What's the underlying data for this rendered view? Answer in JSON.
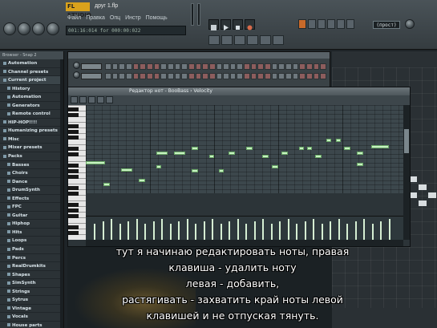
{
  "app": {
    "logo": "FL STUDIO",
    "window_title": "друг 1.flp"
  },
  "menu": [
    "Файл",
    "Правка",
    "Опц",
    "Инстр",
    "Помощь"
  ],
  "hint_panel": "001:16:014 for 000:00:022",
  "bpm_display": "(прост)",
  "browser": {
    "header": "Browser - Snap 2",
    "items": [
      {
        "label": "Automation",
        "level": 0
      },
      {
        "label": "Channel presets",
        "level": 0
      },
      {
        "label": "Current project",
        "level": 0
      },
      {
        "label": "History",
        "level": 1
      },
      {
        "label": "Automation",
        "level": 1
      },
      {
        "label": "Generators",
        "level": 1
      },
      {
        "label": "Remote control",
        "level": 1
      },
      {
        "label": "HIP-HOP!!!!",
        "level": 0
      },
      {
        "label": "Humanizing presets",
        "level": 0
      },
      {
        "label": "Misc",
        "level": 0
      },
      {
        "label": "Mixer presets",
        "level": 0
      },
      {
        "label": "Packs",
        "level": 0
      },
      {
        "label": "Basses",
        "level": 1
      },
      {
        "label": "Choirs",
        "level": 1
      },
      {
        "label": "Dance",
        "level": 1
      },
      {
        "label": "DrumSynth",
        "level": 1
      },
      {
        "label": "Effects",
        "level": 1
      },
      {
        "label": "FPC",
        "level": 1
      },
      {
        "label": "Guitar",
        "level": 1
      },
      {
        "label": "Hiphop",
        "level": 1
      },
      {
        "label": "Hits",
        "level": 1
      },
      {
        "label": "Loops",
        "level": 1
      },
      {
        "label": "Pads",
        "level": 1
      },
      {
        "label": "Percs",
        "level": 1
      },
      {
        "label": "RealDrumkits",
        "level": 1
      },
      {
        "label": "Shapes",
        "level": 1
      },
      {
        "label": "SimSynth",
        "level": 1
      },
      {
        "label": "Strings",
        "level": 1
      },
      {
        "label": "Sytrus",
        "level": 1
      },
      {
        "label": "Vintage",
        "level": 1
      },
      {
        "label": "Vocals",
        "level": 1
      },
      {
        "label": "House parts",
        "level": 1
      }
    ]
  },
  "piano_roll": {
    "title": "Редактор нот - BooBass › Velocity"
  },
  "subtitles": [
    "тут я начинаю редактировать ноты,  правая",
    "клавиша - удалить ноту",
    "левая - добавить,",
    "растягивать - захватить край ноты левой",
    "клавишей и не отпуская тянуть."
  ],
  "colors": {
    "note": "#c7f2c2",
    "grid": "#3c474c",
    "logo": "#d9a21c",
    "subtitle": "#ffffff"
  }
}
